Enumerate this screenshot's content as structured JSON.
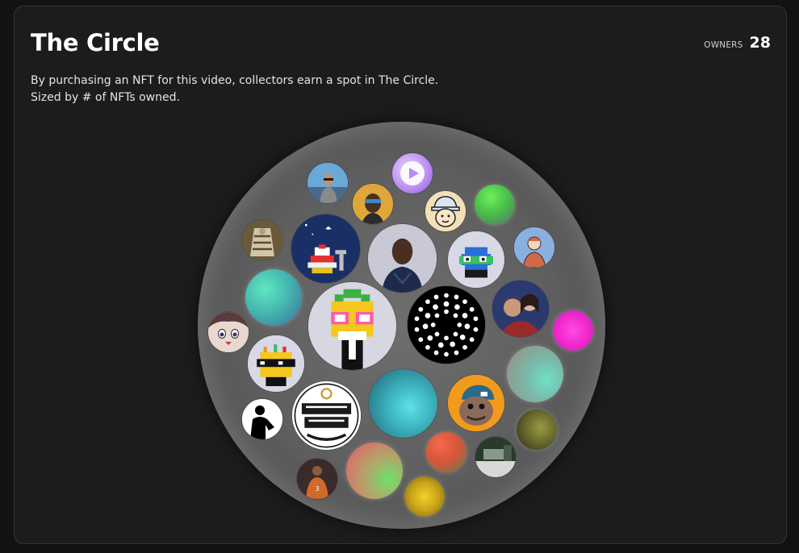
{
  "header": {
    "title": "The Circle",
    "owners_label": "OWNERS",
    "owners_count": "28"
  },
  "description": {
    "line1": "By purchasing an NFT for this video, collectors earn a spot in The Circle.",
    "line2": "Sized by # of NFTs owned."
  },
  "collectors": [
    {
      "name": "collector-pineapple-skull-avatar",
      "icon": "pixel-pineapple-skull-icon",
      "colors": [
        "#d6d7e0"
      ]
    },
    {
      "name": "collector-dot-pattern-avatar",
      "icon": "dot-ring-pattern-icon",
      "colors": [
        "#000000",
        "#ffffff"
      ]
    },
    {
      "name": "collector-teal-gradient-avatar",
      "icon": "gradient-orb-icon",
      "colors": [
        "#3fb9c4",
        "#1b5f70"
      ]
    },
    {
      "name": "collector-hooded-man-avatar",
      "icon": "person-photo-icon",
      "colors": [
        "#c8c8d8",
        "#1e2a4a"
      ]
    },
    {
      "name": "collector-pixel-ufo-avatar",
      "icon": "pixel-robot-icon",
      "colors": [
        "#1a2f66"
      ]
    },
    {
      "name": "collector-fresh-maker-avatar",
      "icon": "fresh-maker-logo-icon",
      "colors": [
        "#ffffff",
        "#1a1a1a"
      ]
    },
    {
      "name": "collector-blue-creature-avatar",
      "icon": "pixel-creature-icon",
      "colors": [
        "#d8d8e6",
        "#2d6fd8"
      ]
    },
    {
      "name": "collector-two-people-avatar",
      "icon": "person-photo-icon",
      "colors": [
        "#2a3a6e",
        "#9a2a2a"
      ]
    },
    {
      "name": "collector-cap-character-avatar",
      "icon": "cartoon-character-icon",
      "colors": [
        "#f29a1c"
      ]
    },
    {
      "name": "collector-pixel-glasses-avatar",
      "icon": "pixel-sunglasses-icon",
      "colors": [
        "#d8d8e6"
      ]
    },
    {
      "name": "collector-mint-gradient-avatar",
      "icon": "gradient-orb-icon",
      "colors": [
        "#6fd3b8",
        "#7aa89a"
      ]
    },
    {
      "name": "collector-sea-gradient-avatar",
      "icon": "gradient-orb-icon",
      "colors": [
        "#5fe0c0",
        "#3a7ea0"
      ]
    },
    {
      "name": "collector-coral-green-avatar",
      "icon": "gradient-orb-icon",
      "colors": [
        "#e85a6a",
        "#6fe06a"
      ]
    },
    {
      "name": "collector-purple-play-avatar",
      "icon": "play-icon",
      "colors": [
        "#b98af0",
        "#ffffff"
      ]
    },
    {
      "name": "collector-magenta-avatar",
      "icon": "gradient-orb-icon",
      "colors": [
        "#f22ad0",
        "#c81ab4"
      ]
    },
    {
      "name": "collector-green-orb-avatar",
      "icon": "gradient-orb-icon",
      "colors": [
        "#5fe05a",
        "#2a7a3a"
      ]
    },
    {
      "name": "collector-hat-kid-avatar",
      "icon": "cartoon-character-icon",
      "colors": [
        "#f4e0b8"
      ]
    },
    {
      "name": "collector-masked-man-avatar",
      "icon": "person-photo-icon",
      "colors": [
        "#e0a63a",
        "#3a3a3a"
      ]
    },
    {
      "name": "collector-photo-man-avatar",
      "icon": "person-photo-icon",
      "colors": [
        "#6aa8d8",
        "#2a3a4a"
      ]
    },
    {
      "name": "collector-gold-art-avatar",
      "icon": "sculpture-icon",
      "colors": [
        "#8a7a5a",
        "#d0c6a8"
      ]
    },
    {
      "name": "collector-sketch-avatar",
      "icon": "sketch-portrait-icon",
      "colors": [
        "#8ab0e0",
        "#d06a4a"
      ]
    },
    {
      "name": "collector-anime-avatar",
      "icon": "anime-face-icon",
      "colors": [
        "#e8d8d0",
        "#5a3a3a"
      ]
    },
    {
      "name": "collector-silhouette-avatar",
      "icon": "silhouette-icon",
      "colors": [
        "#ffffff",
        "#000000"
      ]
    },
    {
      "name": "collector-athlete-avatar",
      "icon": "person-photo-icon",
      "colors": [
        "#d06a2a",
        "#3a2a2a"
      ]
    },
    {
      "name": "collector-red-orb-avatar",
      "icon": "gradient-orb-icon",
      "colors": [
        "#e8563a",
        "#6a7a4a"
      ]
    },
    {
      "name": "collector-room-photo-avatar",
      "icon": "room-photo-icon",
      "colors": [
        "#d8d8d8",
        "#2a3a2a"
      ]
    },
    {
      "name": "collector-olive-orb-avatar",
      "icon": "gradient-orb-icon",
      "colors": [
        "#8a8a3a",
        "#2a2a1a"
      ]
    },
    {
      "name": "collector-gold-orb-avatar",
      "icon": "gradient-orb-icon",
      "colors": [
        "#e8c21a",
        "#8a6a1a"
      ]
    }
  ]
}
